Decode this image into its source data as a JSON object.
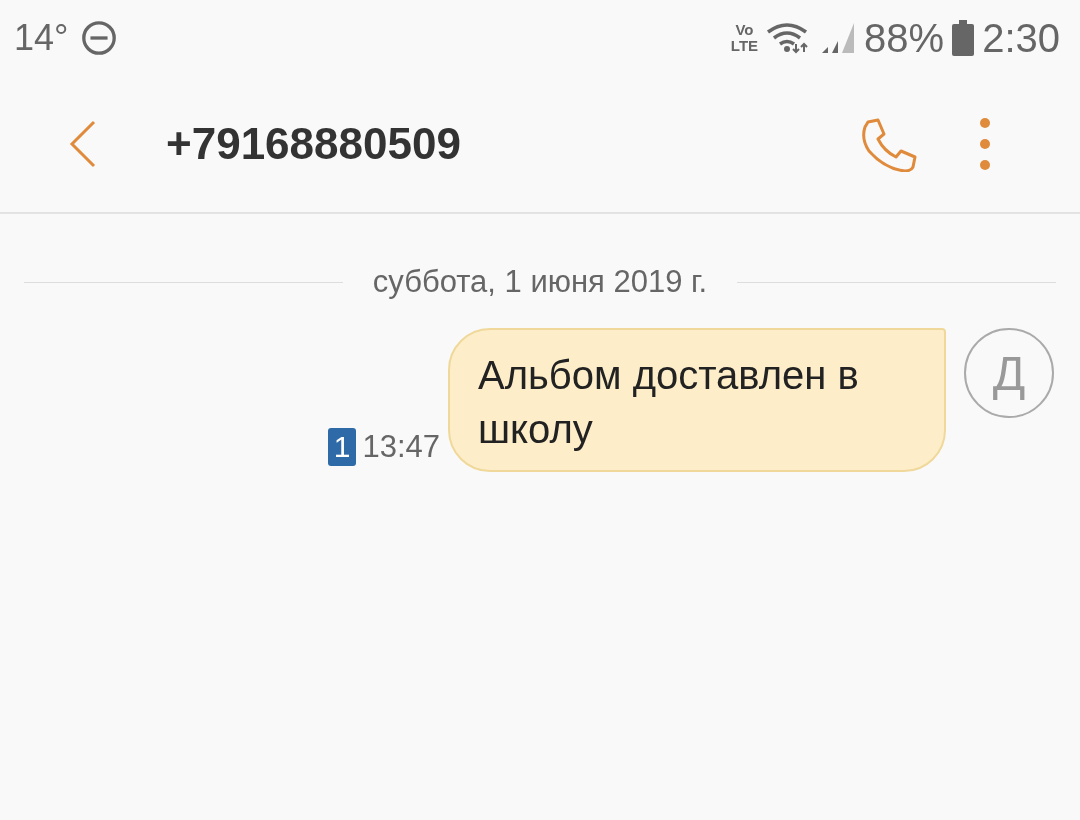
{
  "status_bar": {
    "temperature": "14°",
    "volte_top": "Vo",
    "volte_bottom": "LTE",
    "battery": "88%",
    "time": "2:30"
  },
  "header": {
    "title": "+79168880509"
  },
  "date_divider": "суббота, 1 июня 2019 г.",
  "messages": [
    {
      "text": "Альбом доставлен в школу",
      "sim": "1",
      "time": "13:47",
      "avatar": "Д"
    }
  ]
}
